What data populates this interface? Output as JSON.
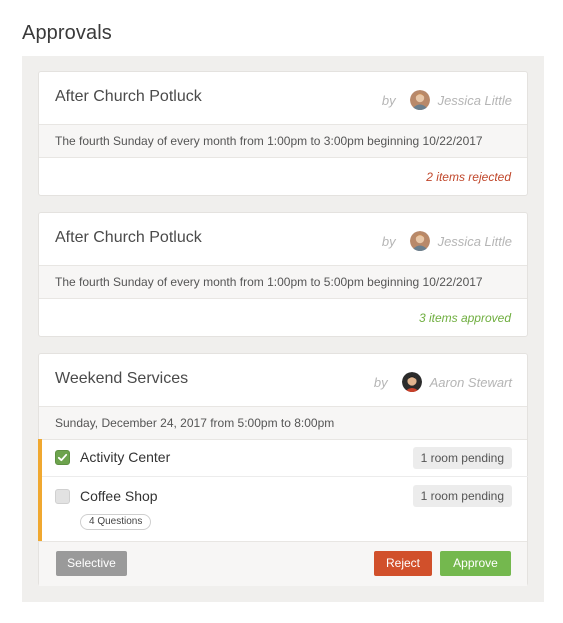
{
  "page": {
    "title": "Approvals"
  },
  "approvals": [
    {
      "title": "After Church Potluck",
      "by_label": "by",
      "author": "Jessica Little",
      "schedule": "The fourth Sunday of every month from 1:00pm to 3:00pm beginning 10/22/2017",
      "status": "2 items rejected",
      "status_color": "#c0472b"
    },
    {
      "title": "After Church Potluck",
      "by_label": "by",
      "author": "Jessica Little",
      "schedule": "The fourth Sunday of every month from 1:00pm to 5:00pm beginning 10/22/2017",
      "status": "3 items approved",
      "status_color": "#6fae3f"
    },
    {
      "title": "Weekend Services",
      "by_label": "by",
      "author": "Aaron Stewart",
      "schedule": "Sunday, December 24, 2017 from 5:00pm to 8:00pm",
      "rooms": [
        {
          "name": "Activity Center",
          "checked": true,
          "pending": "1 room pending"
        },
        {
          "name": "Coffee Shop",
          "checked": false,
          "pending": "1 room pending",
          "questions": "4 Questions"
        }
      ],
      "buttons": {
        "selective": "Selective",
        "reject": "Reject",
        "approve": "Approve"
      }
    }
  ],
  "colors": {
    "pending_accent": "#f0a830",
    "reject": "#d1502b",
    "approve": "#74b84e",
    "selective": "#9a9a9a",
    "checked": "#6da34d"
  }
}
